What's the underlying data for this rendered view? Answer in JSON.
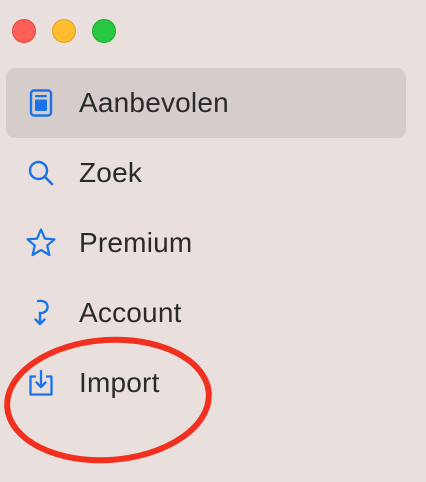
{
  "window_controls": {
    "close": "close",
    "minimize": "minimize",
    "zoom": "zoom"
  },
  "sidebar": {
    "items": [
      {
        "label": "Aanbevolen",
        "icon": "featured-icon",
        "selected": true
      },
      {
        "label": "Zoek",
        "icon": "search-icon",
        "selected": false
      },
      {
        "label": "Premium",
        "icon": "star-icon",
        "selected": false
      },
      {
        "label": "Account",
        "icon": "account-icon",
        "selected": false
      },
      {
        "label": "Import",
        "icon": "import-icon",
        "selected": false
      }
    ]
  },
  "colors": {
    "accent": "#1a73e8",
    "background": "#e9e0dd",
    "selected_background": "#d6cdcb",
    "annotation": "#f2301f"
  }
}
